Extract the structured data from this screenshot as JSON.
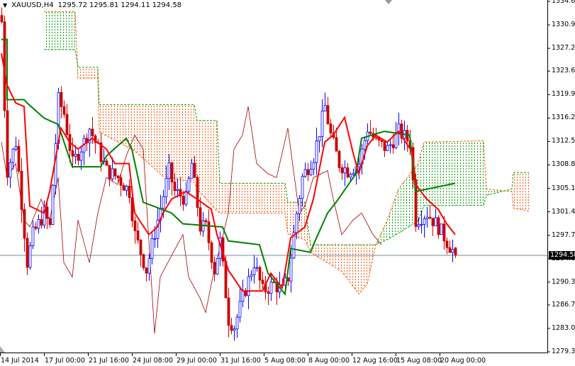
{
  "header": {
    "symbol": "XAUUSD,H4",
    "open": "1295.72",
    "high": "1295.81",
    "low": "1294.11",
    "close": "1294.58",
    "menu_icon": "triangle-down-icon"
  },
  "current_price_label": "1294.58",
  "colors": {
    "up": "#0000ff",
    "down": "#cc0000",
    "tenkan": "#ff0000",
    "kijun": "#008000",
    "chikou": "#a00000",
    "cloud_bull": "#00a000",
    "cloud_bear": "#ff5500",
    "price_line": "#778899"
  },
  "chart_data": {
    "type": "candlestick",
    "title": "XAUUSD,H4",
    "ylim": [
      1279.3,
      1334.6
    ],
    "y_ticks": [
      "1334.60",
      "1330.90",
      "1327.20",
      "1323.60",
      "1319.90",
      "1316.20",
      "1312.50",
      "1308.80",
      "1305.10",
      "1301.40",
      "1297.70",
      "1294.00",
      "1290.30",
      "1286.70",
      "1283.00",
      "1279.30"
    ],
    "x_ticks": [
      "14 Jul 2014",
      "17 Jul 00:00",
      "21 Jul 16:00",
      "24 Jul 08:00",
      "29 Jul 00:00",
      "31 Jul 16:00",
      "5 Aug 08:00",
      "8 Aug 00:00",
      "12 Aug 16:00",
      "15 Aug 08:00",
      "20 Aug 00:00"
    ],
    "last_bar": {
      "open": 1295.72,
      "high": 1295.81,
      "low": 1294.11,
      "close": 1294.58
    },
    "close_path": [
      [
        0,
        1331.4
      ],
      [
        1,
        1318
      ],
      [
        2,
        1307.9
      ],
      [
        5,
        1312.4
      ],
      [
        9,
        1293.4
      ],
      [
        11,
        1297.8
      ],
      [
        15,
        1301.2
      ],
      [
        17,
        1299
      ],
      [
        20,
        1319.1
      ],
      [
        22,
        1316.9
      ],
      [
        25,
        1309
      ],
      [
        29,
        1312.4
      ],
      [
        31,
        1314.6
      ],
      [
        34,
        1311.3
      ],
      [
        37,
        1307.9
      ],
      [
        41,
        1306.8
      ],
      [
        45,
        1304.6
      ],
      [
        47,
        1297.8
      ],
      [
        51,
        1292.2
      ],
      [
        55,
        1300.1
      ],
      [
        59,
        1307.9
      ],
      [
        61,
        1304.6
      ],
      [
        65,
        1303.4
      ],
      [
        67,
        1309
      ],
      [
        70,
        1299
      ],
      [
        72,
        1299
      ],
      [
        75,
        1292.2
      ],
      [
        77,
        1296.7
      ],
      [
        80,
        1284.4
      ],
      [
        82,
        1283.3
      ],
      [
        85,
        1287.8
      ],
      [
        89,
        1293.4
      ],
      [
        92,
        1288.9
      ],
      [
        96,
        1290
      ],
      [
        99,
        1288.9
      ],
      [
        101,
        1291.1
      ],
      [
        104,
        1301.2
      ],
      [
        106,
        1306.8
      ],
      [
        110,
        1310.2
      ],
      [
        114,
        1318
      ],
      [
        116,
        1313.5
      ],
      [
        119,
        1309
      ],
      [
        122,
        1307.9
      ],
      [
        126,
        1309
      ],
      [
        129,
        1314.6
      ],
      [
        132,
        1312.4
      ],
      [
        136,
        1311.3
      ],
      [
        140,
        1314.1
      ],
      [
        144,
        1312.4
      ],
      [
        146,
        1300.1
      ],
      [
        150,
        1301.2
      ],
      [
        154,
        1299
      ],
      [
        157,
        1296.7
      ],
      [
        160,
        1294.58
      ]
    ],
    "tenkan": [
      [
        0,
        1326.4
      ],
      [
        2,
        1321.4
      ],
      [
        5,
        1318.6
      ],
      [
        8,
        1318
      ],
      [
        10,
        1302.3
      ],
      [
        15,
        1301.2
      ],
      [
        17,
        1304.6
      ],
      [
        21,
        1314.6
      ],
      [
        24,
        1312.4
      ],
      [
        27,
        1311.3
      ],
      [
        32,
        1313
      ],
      [
        37,
        1311.3
      ],
      [
        40,
        1309
      ],
      [
        45,
        1309
      ],
      [
        47,
        1301.2
      ],
      [
        52,
        1297.8
      ],
      [
        55,
        1299
      ],
      [
        57,
        1301.2
      ],
      [
        60,
        1303.4
      ],
      [
        65,
        1304.6
      ],
      [
        69,
        1303.4
      ],
      [
        74,
        1301.8
      ],
      [
        76,
        1297.8
      ],
      [
        80,
        1292.2
      ],
      [
        85,
        1288.9
      ],
      [
        92,
        1288.9
      ],
      [
        95,
        1291.7
      ],
      [
        99,
        1289.4
      ],
      [
        102,
        1297.3
      ],
      [
        107,
        1299
      ],
      [
        110,
        1303.4
      ],
      [
        114,
        1312.4
      ],
      [
        117,
        1313.5
      ],
      [
        121,
        1316.3
      ],
      [
        124,
        1310.7
      ],
      [
        126,
        1307.4
      ],
      [
        129,
        1311.8
      ],
      [
        132,
        1313.5
      ],
      [
        136,
        1312.4
      ],
      [
        140,
        1314.1
      ],
      [
        145,
        1310.7
      ],
      [
        146,
        1305.7
      ],
      [
        150,
        1303.4
      ],
      [
        154,
        1301.8
      ],
      [
        157,
        1299.5
      ],
      [
        160,
        1297.8
      ]
    ],
    "kijun": [
      [
        0,
        1328.6
      ],
      [
        2,
        1328.6
      ],
      [
        2,
        1319.1
      ],
      [
        8,
        1319.1
      ],
      [
        9,
        1318.6
      ],
      [
        15,
        1316.2
      ],
      [
        20,
        1315.2
      ],
      [
        25,
        1308.5
      ],
      [
        35,
        1308.5
      ],
      [
        37,
        1310.2
      ],
      [
        44,
        1313
      ],
      [
        46,
        1311.3
      ],
      [
        50,
        1302.9
      ],
      [
        60,
        1301.2
      ],
      [
        64,
        1299.5
      ],
      [
        78,
        1299
      ],
      [
        80,
        1296.8
      ],
      [
        91,
        1296.2
      ],
      [
        94,
        1291.7
      ],
      [
        100,
        1288.4
      ],
      [
        102,
        1295.6
      ],
      [
        109,
        1295
      ],
      [
        110,
        1296.2
      ],
      [
        115,
        1301.2
      ],
      [
        118,
        1302.9
      ],
      [
        125,
        1307.4
      ],
      [
        127,
        1313
      ],
      [
        135,
        1314.1
      ],
      [
        144,
        1313.5
      ],
      [
        146,
        1304.6
      ],
      [
        160,
        1305.9
      ]
    ],
    "chikou": [
      [
        0,
        1312.4
      ],
      [
        2,
        1306.8
      ],
      [
        5,
        1309
      ],
      [
        8,
        1300.1
      ],
      [
        10,
        1299
      ],
      [
        14,
        1303.4
      ],
      [
        17,
        1300.1
      ],
      [
        20,
        1306.8
      ],
      [
        22,
        1293.4
      ],
      [
        25,
        1291.1
      ],
      [
        27,
        1300.1
      ],
      [
        31,
        1293.4
      ],
      [
        34,
        1301.2
      ],
      [
        37,
        1306.8
      ],
      [
        41,
        1305.7
      ],
      [
        44,
        1310.2
      ],
      [
        47,
        1313.5
      ],
      [
        50,
        1311.3
      ],
      [
        54,
        1282.2
      ],
      [
        56,
        1291.1
      ],
      [
        60,
        1294.5
      ],
      [
        64,
        1297.8
      ],
      [
        66,
        1291.1
      ],
      [
        70,
        1287.8
      ],
      [
        72,
        1285.5
      ],
      [
        75,
        1292.2
      ],
      [
        77,
        1295.6
      ],
      [
        80,
        1301.2
      ],
      [
        82,
        1311.3
      ],
      [
        85,
        1313.5
      ],
      [
        87,
        1318
      ],
      [
        90,
        1309
      ],
      [
        94,
        1307.4
      ],
      [
        97,
        1306.8
      ],
      [
        101,
        1314.6
      ],
      [
        105,
        1301.2
      ],
      [
        107,
        1302.3
      ],
      [
        110,
        1306.8
      ],
      [
        115,
        1307.9
      ],
      [
        117,
        1303.4
      ],
      [
        120,
        1297.8
      ],
      [
        124,
        1300.1
      ],
      [
        127,
        1301.2
      ],
      [
        131,
        1297.8
      ],
      [
        134,
        1296.2
      ]
    ],
    "cloud": [
      [
        15,
        1333,
        1327
      ],
      [
        26,
        1333,
        1327
      ],
      [
        27,
        1322.5,
        1324.2
      ],
      [
        34,
        1322.5,
        1324.2
      ],
      [
        34.5,
        1314,
        1318.3
      ],
      [
        47,
        1311,
        1318.3
      ],
      [
        57,
        1307,
        1318.3
      ],
      [
        68,
        1306,
        1318.3
      ],
      [
        69,
        1305,
        1315.8
      ],
      [
        76,
        1301.5,
        1315.8
      ],
      [
        77,
        1301.2,
        1305.9
      ],
      [
        100,
        1301.2,
        1305.9
      ],
      [
        101,
        1297.9,
        1302.9
      ],
      [
        107,
        1297,
        1302.9
      ],
      [
        109,
        1295,
        1296.2
      ],
      [
        120,
        1292,
        1296.2
      ],
      [
        126,
        1288.4,
        1296.2
      ],
      [
        129,
        1290,
        1296.2
      ],
      [
        132,
        1296.2,
        1296.2
      ],
      [
        136,
        1300,
        1297
      ],
      [
        140,
        1305,
        1298
      ],
      [
        147,
        1309,
        1300
      ],
      [
        149,
        1312.4,
        1302.4
      ],
      [
        170,
        1312.6,
        1302.4
      ],
      [
        171,
        1305,
        1304
      ],
      [
        180,
        1304.6,
        1305
      ],
      [
        180.5,
        1302,
        1307.6
      ],
      [
        186,
        1301.5,
        1307.6
      ]
    ]
  }
}
